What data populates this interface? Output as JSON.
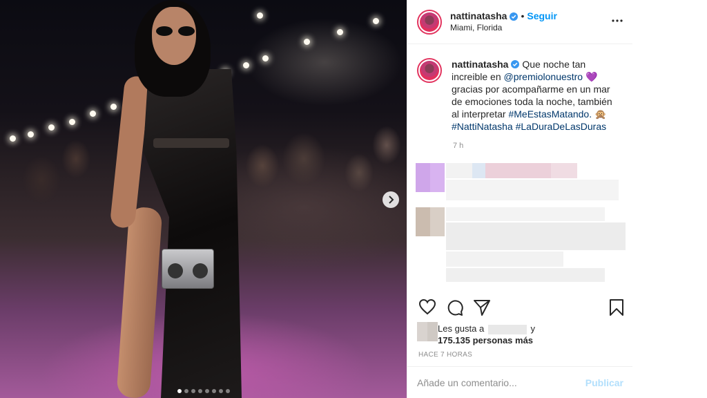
{
  "post": {
    "username": "nattinatasha",
    "follow_label": "Seguir",
    "separator": "•",
    "location": "Miami, Florida",
    "caption": {
      "text_1": "Que noche tan increible en",
      "mention": "@premiolonuestro",
      "text_2": "gracias por acompañarme en un mar de emociones toda la noche, también al interpretar",
      "hashtag_1": "#MeEstasMatando.",
      "hashtag_2": "#NattiNatasha",
      "hashtag_3": "#LaDuraDeLasDuras"
    },
    "caption_time": "7 h",
    "likes_prefix": "Les gusta a",
    "likes_suffix": "y",
    "likes_count": "175.135 personas más",
    "posted_ago": "HACE 7 HORAS",
    "comment_placeholder": "Añade un comentario...",
    "publish_label": "Publicar"
  },
  "carousel": {
    "total": 8,
    "active_index": 0
  },
  "colors": {
    "accent": "#0095f6",
    "verified": "#3897f0",
    "link": "#00376b",
    "avatar_ring": "#e2335e",
    "publish_disabled": "#b2dffc"
  },
  "icons": [
    "verified-icon",
    "more-options-icon",
    "heart-icon",
    "comment-icon",
    "share-icon",
    "bookmark-icon",
    "chevron-right-icon"
  ]
}
